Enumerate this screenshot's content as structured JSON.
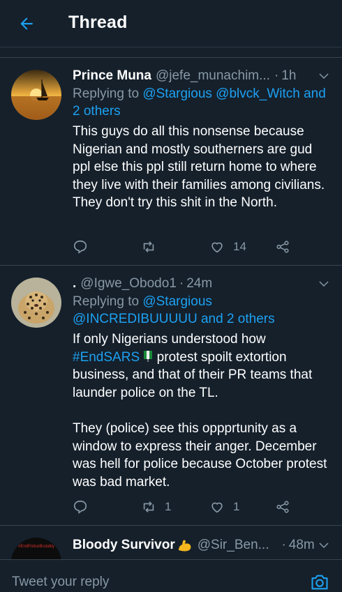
{
  "header": {
    "title": "Thread"
  },
  "tweets": [
    {
      "name": "Prince Muna",
      "handle": "@jefe_munachim...",
      "time": "1h",
      "replying_prefix": "Replying to",
      "replying_mentions": "@Stargious @blvck_Witch and 2 others",
      "body": "This guys do all this nonsense because Nigerian and mostly southerners are gud ppl else this ppl still return home to where they live with their families among civilians. They don't try this shit in the North.",
      "retweets": "",
      "likes": "14"
    },
    {
      "name": ".",
      "handle": "@Igwe_Obodo1",
      "time": "24m",
      "replying_prefix": "Replying to",
      "replying_mentions": "@Stargious @INCREDIBUUUUU and 2 others",
      "body_pre": "If only Nigerians understood how",
      "hashtag": "#EndSARS",
      "body_post": " protest spoilt extortion business, and that of their PR teams that launder police on the TL.\n\nThey (police) see this oppprtunity as a window to express their anger. December was hell for police because October protest was bad market.",
      "retweets": "1",
      "likes": "1"
    },
    {
      "name": "Bloody Survivor",
      "handle": "@Sir_Ben...",
      "time": "48m",
      "avatar_text": "#EndPoliceBrutality"
    }
  ],
  "composer": {
    "placeholder": "Tweet your reply"
  },
  "colors": {
    "background": "#15202b",
    "accent": "#1da1f2",
    "muted": "#8899a6",
    "divider": "#38444d"
  },
  "icons": {
    "back": "arrow-left-icon",
    "more": "chevron-down-icon",
    "reply": "reply-icon",
    "retweet": "retweet-icon",
    "like": "heart-icon",
    "share": "share-icon",
    "camera": "camera-icon",
    "emoji": "flexed-biceps-emoji",
    "flag": "nigeria-flag-emoji"
  }
}
